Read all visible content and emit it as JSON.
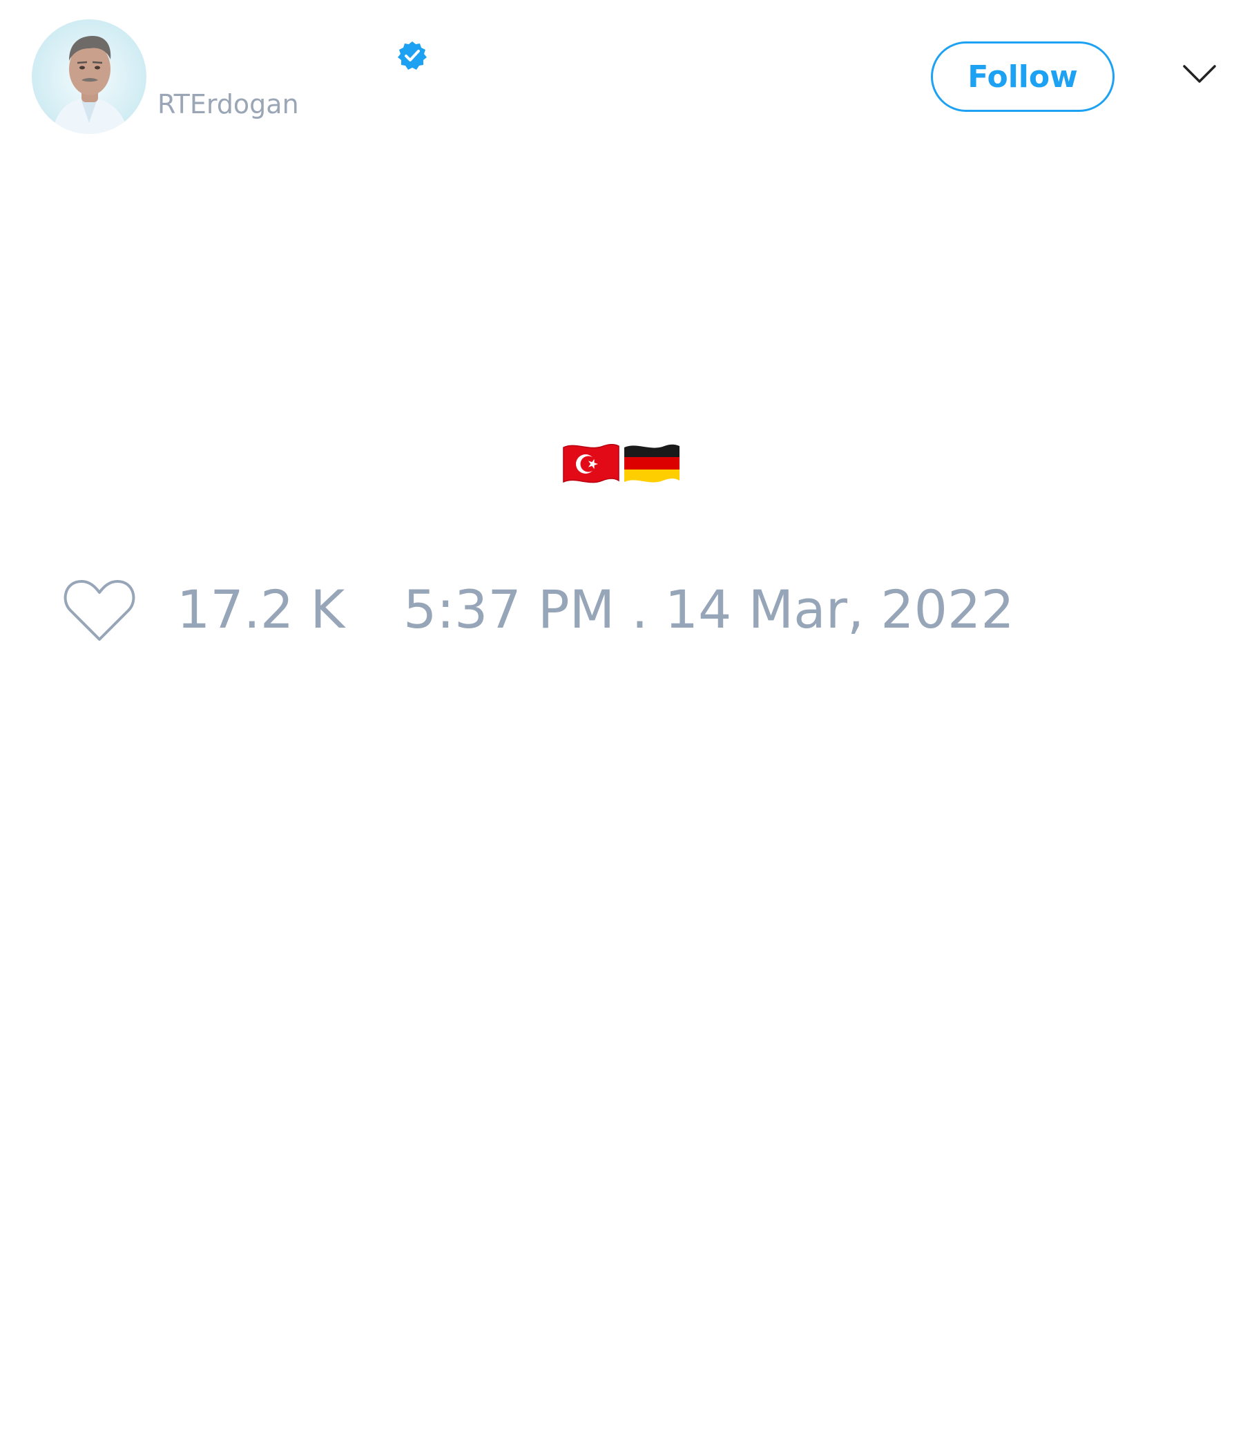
{
  "tweet": {
    "author": {
      "display_name": "",
      "handle": "RTErdogan",
      "verified": true,
      "avatar_icon": "profile-photo"
    },
    "follow_label": "Follow",
    "menu_icon": "chevron-down-icon",
    "text": "🇹🇷🇩🇪",
    "text_flags": [
      "turkey-flag",
      "germany-flag"
    ],
    "likes": "17.2 K",
    "like_icon": "heart-outline-icon",
    "timestamp": "5:37 PM . 14 Mar, 2022"
  },
  "colors": {
    "accent": "#1da1f2",
    "muted_text": "#97a5b8",
    "background": "#ffffff"
  }
}
